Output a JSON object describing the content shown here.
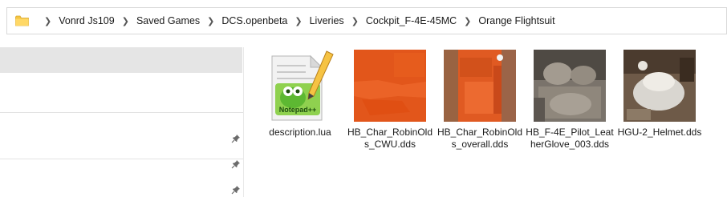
{
  "breadcrumb": {
    "icon": "folder-icon",
    "items": [
      "Vonrd Js109",
      "Saved Games",
      "DCS.openbeta",
      "Liveries",
      "Cockpit_F-4E-45MC",
      "Orange Flightsuit"
    ]
  },
  "nav_pane": {
    "pins": [
      "pin-icon",
      "pin-icon",
      "pin-icon"
    ]
  },
  "files": [
    {
      "name": "description.lua",
      "thumbnail": "notepad-plus-plus-icon"
    },
    {
      "name": "HB_Char_RobinOlds_CWU.dds",
      "thumbnail": "orange-texture"
    },
    {
      "name": "HB_Char_RobinOlds_overall.dds",
      "thumbnail": "orange-overall-texture"
    },
    {
      "name": "HB_F-4E_Pilot_LeatherGlove_003.dds",
      "thumbnail": "leather-glove-texture"
    },
    {
      "name": "HGU-2_Helmet.dds",
      "thumbnail": "helmet-texture"
    }
  ],
  "colors": {
    "selection": "#e5e5e5",
    "folder": "#f4c542",
    "orange": "#e85a1e"
  }
}
